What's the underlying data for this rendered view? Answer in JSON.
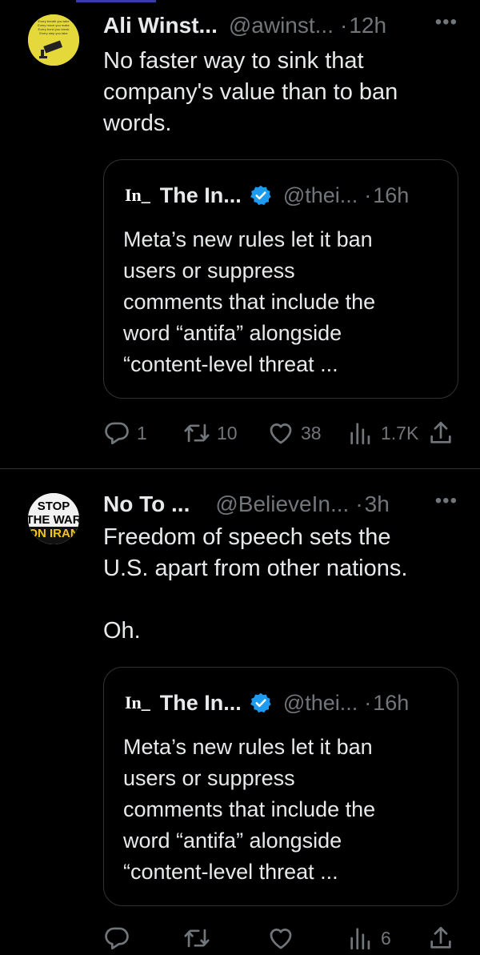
{
  "tweets": [
    {
      "name": "Ali Winst...",
      "handle": "@awinst...",
      "time": "12h",
      "text": [
        "No faster way to sink that",
        "company's value than to ban",
        "words."
      ],
      "quote": {
        "logo": "In_",
        "name": "The In...",
        "handle": "@thei...",
        "time": "16h",
        "text": [
          "Meta’s new rules let it ban",
          "users or suppress",
          "comments that include the",
          "word “antifa” alongside",
          "“content-level threat ..."
        ]
      },
      "actions": {
        "replies": "1",
        "reposts": "10",
        "likes": "38",
        "views": "1.7K"
      }
    },
    {
      "name": "No To ...",
      "handle": "@BelieveIn...",
      "time": "3h",
      "text": [
        "Freedom of speech sets the",
        "U.S. apart from other nations.",
        "",
        "Oh."
      ],
      "quote": {
        "logo": "In_",
        "name": "The In...",
        "handle": "@thei...",
        "time": "16h",
        "text": [
          "Meta’s new rules let it ban",
          "users or suppress",
          "comments that include the",
          "word “antifa” alongside",
          "“content-level threat ..."
        ]
      },
      "actions": {
        "replies": "",
        "reposts": "",
        "likes": "",
        "views": "6"
      }
    }
  ],
  "avatar2_text": [
    "STOP",
    "THE WAR",
    "ON IRAN"
  ],
  "avatar1_text": [
    "Every breath you take",
    "Every move you make",
    "Every bond you break",
    "Every step you take"
  ],
  "ui": {
    "more": "•••",
    "dot": "·"
  },
  "colors": {
    "background": "#000000",
    "text": "#e7e9ea",
    "muted": "#71767b",
    "verified": "#1d9bf0",
    "divider": "#2f3336"
  },
  "icons": [
    "more-icon",
    "verified-icon",
    "reply-icon",
    "repost-icon",
    "like-icon",
    "views-icon",
    "share-icon"
  ]
}
